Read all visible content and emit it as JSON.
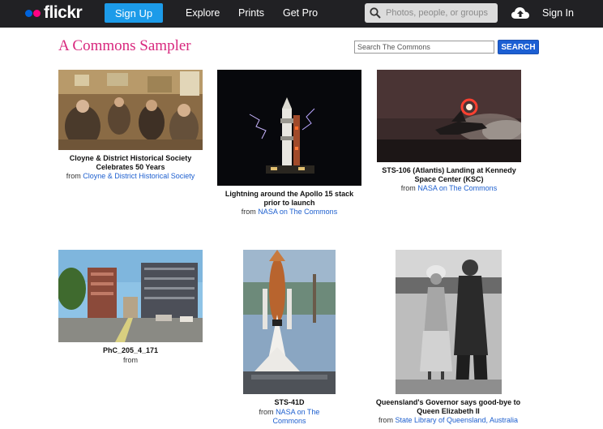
{
  "header": {
    "logo_text": "flickr",
    "signup_label": "Sign Up",
    "nav": [
      "Explore",
      "Prints",
      "Get Pro"
    ],
    "search_placeholder": "Photos, people, or groups",
    "signin_label": "Sign In"
  },
  "page": {
    "title": "A Commons Sampler",
    "search_placeholder": "Search The Commons",
    "search_button": "SEARCH"
  },
  "photos": [
    {
      "title": "Cloyne & District Historical Society Celebrates 50 Years",
      "from_label": "from",
      "source": "Cloyne & District Historical Society"
    },
    {
      "title": "Lightning around the Apollo 15 stack prior to launch",
      "from_label": "from",
      "source": "NASA on The Commons"
    },
    {
      "title": "STS-106 (Atlantis) Landing at Kennedy Space Center (KSC)",
      "from_label": "from",
      "source": "NASA on The Commons"
    },
    {
      "title": "PhC_205_4_171",
      "from_label": "from",
      "source": ""
    },
    {
      "title": "STS-41D",
      "from_label": "from",
      "source": "NASA on The Commons"
    },
    {
      "title": "Queensland's Governor says good-bye to Queen Elizabeth II",
      "from_label": "from",
      "source": "State Library of Queensland, Australia"
    }
  ],
  "colors": {
    "topbar": "#212124",
    "accent_title": "#d8287e",
    "link": "#1d5fcf",
    "signup": "#1c9be9"
  }
}
